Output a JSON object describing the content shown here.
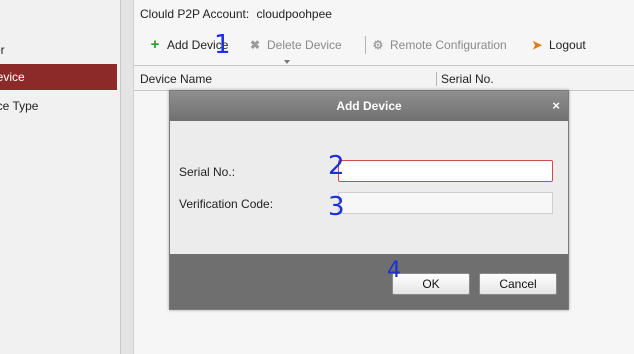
{
  "sidebar": {
    "items": [
      {
        "label": "ver",
        "active": false
      },
      {
        "label": "Device",
        "active": true
      },
      {
        "label": "vice Type",
        "active": false
      }
    ]
  },
  "main": {
    "account_label": "Clould P2P Account:",
    "account_name": "cloudpoohpee",
    "toolbar": {
      "add_device": "Add Device",
      "delete_device": "Delete Device",
      "remote_configuration": "Remote Configuration",
      "logout": "Logout"
    },
    "table": {
      "columns": [
        "Device Name",
        "Serial No."
      ]
    }
  },
  "dialog": {
    "title": "Add Device",
    "close": "×",
    "serial_label": "Serial No.:",
    "serial_value": "",
    "verification_label": "Verification Code:",
    "verification_value": "",
    "ok": "OK",
    "cancel": "Cancel"
  },
  "annotations": [
    "1",
    "2",
    "3",
    "4"
  ],
  "colors": {
    "active_sidebar": "#8c2a2a",
    "dialog_title_bar": "#808080",
    "focus_border": "#d24a4a",
    "add_icon": "#2e9a2e",
    "logout_icon": "#e07b1a",
    "handwriting": "#1c2fd8"
  },
  "icons": {
    "add_device": "plus-icon",
    "delete_device": "x-icon",
    "remote_configuration": "gear-icon",
    "logout": "logout-arrow-icon"
  }
}
